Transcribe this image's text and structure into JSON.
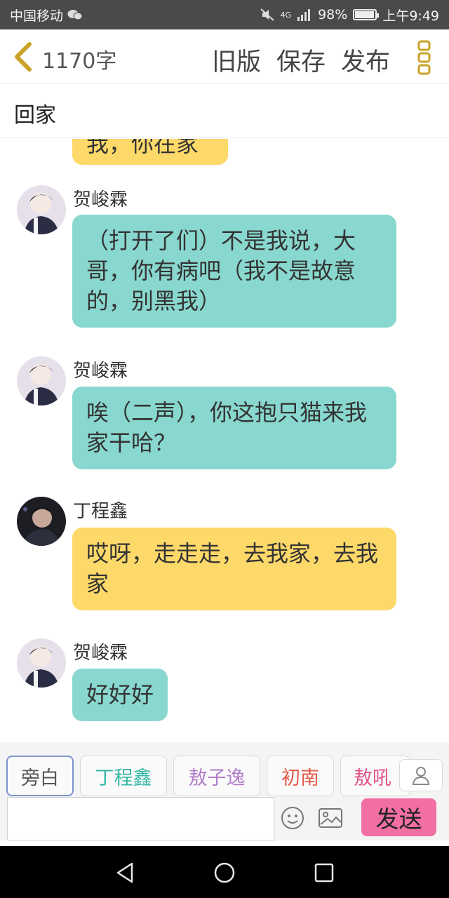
{
  "status_bar": {
    "carrier": "中国移动",
    "network": "4G",
    "battery": "98%",
    "battery_level": 0.98,
    "time": "上午9:49",
    "icons": [
      "wechat-icon",
      "mute-icon",
      "signal-icon",
      "battery-icon"
    ]
  },
  "header": {
    "char_count": "1170字",
    "buttons": {
      "old_version": "旧版",
      "save": "保存",
      "publish": "发布"
    },
    "icons": [
      "back-chevron-icon",
      "more-icon"
    ],
    "accent_color": "#c9a227"
  },
  "title": {
    "text": "回家"
  },
  "chat": {
    "partial_top_text": "我，你在家",
    "messages": [
      {
        "sender": "贺峻霖",
        "text": "（打开了们）不是我说，大哥，你有病吧（我不是故意的，别黑我）",
        "color": "#89d8cf"
      },
      {
        "sender": "贺峻霖",
        "text": "唉（二声），你这抱只猫来我家干哈？",
        "color": "#89d8cf"
      },
      {
        "sender": "丁程鑫",
        "text": "哎呀，走走走，去我家，去我家",
        "color": "#fdd96a"
      },
      {
        "sender": "贺峻霖",
        "text": "好好好",
        "color": "#89d8cf"
      }
    ]
  },
  "toolbar": {
    "roles": [
      {
        "label": "旁白",
        "color": "#555555",
        "selected": true
      },
      {
        "label": "丁程鑫",
        "color": "#36b8a6",
        "selected": false
      },
      {
        "label": "敖子逸",
        "color": "#b07cc9",
        "selected": false
      },
      {
        "label": "初南",
        "color": "#e05a4a",
        "selected": false
      },
      {
        "label": "敖吼",
        "color": "#e0558a",
        "selected": false
      }
    ],
    "input_value": "",
    "send_label": "发送",
    "send_color": "#f26fa4",
    "icons": [
      "person-icon",
      "emoji-icon",
      "image-icon"
    ]
  },
  "navbar": {
    "icons": [
      "back-triangle-icon",
      "home-circle-icon",
      "recents-square-icon"
    ]
  }
}
